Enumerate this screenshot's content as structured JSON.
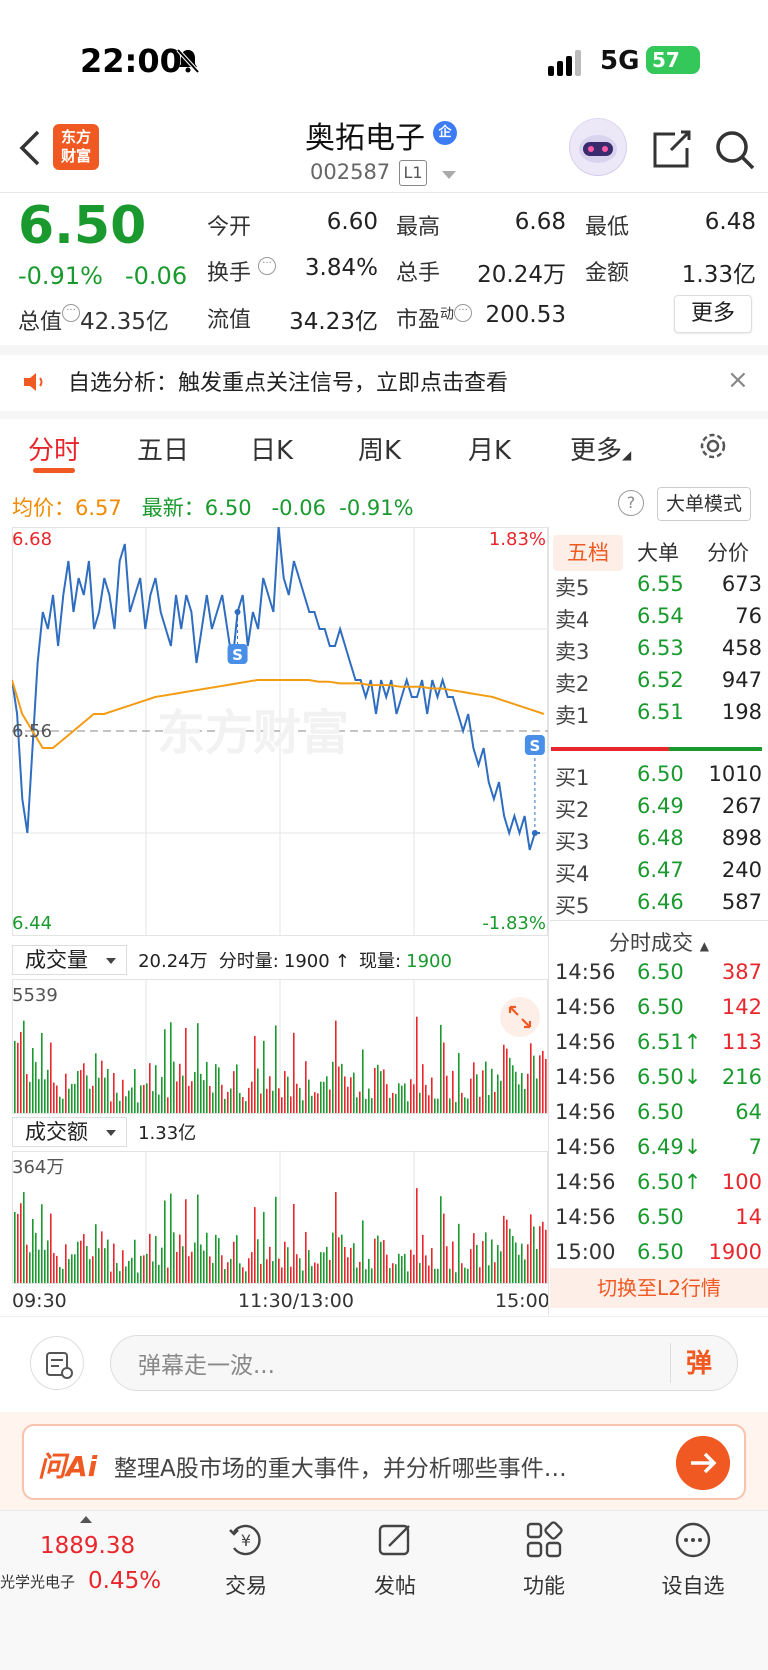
{
  "status_bar": {
    "time": "22:00",
    "network": "5G",
    "battery": "57"
  },
  "header": {
    "logo_text": "东方财富",
    "stock_name": "奥拓电子",
    "verify_badge": "企",
    "stock_code": "002587",
    "level": "L1"
  },
  "quote": {
    "price": "6.50",
    "change_pct": "-0.91%",
    "change_abs": "-0.06",
    "rows": [
      [
        {
          "label": "今开",
          "value": "6.60",
          "color": "red"
        },
        {
          "label": "最高",
          "value": "6.68",
          "color": "red"
        },
        {
          "label": "最低",
          "value": "6.48",
          "color": "green"
        }
      ],
      [
        {
          "label": "换手",
          "value": "3.84%",
          "color": "black"
        },
        {
          "label": "总手",
          "value": "20.24万",
          "color": "black"
        },
        {
          "label": "金额",
          "value": "1.33亿",
          "color": "black"
        }
      ]
    ],
    "total_mv_label": "总值",
    "total_mv": "42.35亿",
    "float_mv_label": "流值",
    "float_mv": "34.23亿",
    "pe_label": "市盈",
    "pe_sup": "动",
    "pe": "200.53",
    "more": "更多"
  },
  "banner": {
    "text": "自选分析：触发重点关注信号，立即点击查看",
    "close": "×"
  },
  "tabs": [
    "分时",
    "五日",
    "日K",
    "周K",
    "月K",
    "更多"
  ],
  "avg_row": {
    "avg_label": "均价：",
    "avg_value": "6.57",
    "latest_label": "最新：",
    "latest_value": "6.50",
    "change": "-0.06",
    "change_pct": "-0.91%",
    "help": "?",
    "mode": "大单模式"
  },
  "chart_data": {
    "type": "line",
    "title": "",
    "ylim": [
      6.44,
      6.68
    ],
    "y_top_label": "6.68",
    "y_bottom_label": "6.44",
    "y_mid_label": "6.56",
    "pct_top": "1.83%",
    "pct_bottom": "-1.83%",
    "x_labels": [
      "09:30",
      "11:30/13:00",
      "15:00"
    ],
    "series": [
      {
        "values": [
          6.59,
          6.57,
          6.52,
          6.5,
          6.55,
          6.6,
          6.63,
          6.62,
          6.64,
          6.61,
          6.64,
          6.66,
          6.63,
          6.65,
          6.64,
          6.66,
          6.62,
          6.63,
          6.65,
          6.64,
          6.62,
          6.66,
          6.67,
          6.63,
          6.64,
          6.65,
          6.62,
          6.64,
          6.65,
          6.63,
          6.62,
          6.61,
          6.64,
          6.62,
          6.64,
          6.63,
          6.6,
          6.62,
          6.64,
          6.62,
          6.63,
          6.64,
          6.62,
          6.6,
          6.63,
          6.64,
          6.61,
          6.63,
          6.62,
          6.65,
          6.64,
          6.63,
          6.68,
          6.65,
          6.64,
          6.66,
          6.65,
          6.64,
          6.63,
          6.63,
          6.62,
          6.62,
          6.61,
          6.61,
          6.62,
          6.61,
          6.6,
          6.59,
          6.59,
          6.58,
          6.59,
          6.57,
          6.59,
          6.58,
          6.59,
          6.57,
          6.58,
          6.59,
          6.58,
          6.58,
          6.59,
          6.57,
          6.59,
          6.58,
          6.59,
          6.58,
          6.58,
          6.57,
          6.56,
          6.57,
          6.55,
          6.54,
          6.55,
          6.53,
          6.52,
          6.53,
          6.51,
          6.5,
          6.51,
          6.5,
          6.51,
          6.49,
          6.5,
          6.5
        ]
      },
      {
        "values": [
          6.59,
          6.57,
          6.56,
          6.55,
          6.55,
          6.555,
          6.56,
          6.565,
          6.57,
          6.57,
          6.572,
          6.574,
          6.576,
          6.578,
          6.58,
          6.581,
          6.582,
          6.583,
          6.584,
          6.585,
          6.586,
          6.587,
          6.588,
          6.589,
          6.59,
          6.59,
          6.59,
          6.59,
          6.59,
          6.59,
          6.589,
          6.589,
          6.588,
          6.588,
          6.588,
          6.587,
          6.587,
          6.587,
          6.586,
          6.586,
          6.586,
          6.585,
          6.585,
          6.584,
          6.583,
          6.582,
          6.581,
          6.58,
          6.578,
          6.576,
          6.574,
          6.572,
          6.57
        ]
      }
    ],
    "events": [
      {
        "label": "S"
      },
      {
        "label": "S"
      }
    ]
  },
  "volume": {
    "label": "成交量",
    "total": "20.24万",
    "minute_label": "分时量:",
    "minute_value": "1900",
    "arrow": "↑",
    "now_label": "现量:",
    "now_value": "1900",
    "max_label": "5539"
  },
  "amount": {
    "label": "成交额",
    "total": "1.33亿",
    "max_label": "364万"
  },
  "order_book": {
    "tabs": [
      "五档",
      "大单",
      "分价"
    ],
    "asks": [
      {
        "label": "卖5",
        "price": "6.55",
        "vol": "673"
      },
      {
        "label": "卖4",
        "price": "6.54",
        "vol": "76"
      },
      {
        "label": "卖3",
        "price": "6.53",
        "vol": "458"
      },
      {
        "label": "卖2",
        "price": "6.52",
        "vol": "947"
      },
      {
        "label": "卖1",
        "price": "6.51",
        "vol": "198"
      }
    ],
    "bids": [
      {
        "label": "买1",
        "price": "6.50",
        "vol": "1010"
      },
      {
        "label": "买2",
        "price": "6.49",
        "vol": "267"
      },
      {
        "label": "买3",
        "price": "6.48",
        "vol": "898"
      },
      {
        "label": "买4",
        "price": "6.47",
        "vol": "240"
      },
      {
        "label": "买5",
        "price": "6.46",
        "vol": "587"
      }
    ]
  },
  "ticks": {
    "title": "分时成交",
    "rows": [
      {
        "time": "14:56",
        "price": "6.50",
        "vol": "387",
        "vcolor": "red"
      },
      {
        "time": "14:56",
        "price": "6.50",
        "vol": "142",
        "vcolor": "red"
      },
      {
        "time": "14:56",
        "price": "6.51↑",
        "vol": "113",
        "vcolor": "red"
      },
      {
        "time": "14:56",
        "price": "6.50↓",
        "vol": "216",
        "vcolor": "green"
      },
      {
        "time": "14:56",
        "price": "6.50",
        "vol": "64",
        "vcolor": "green"
      },
      {
        "time": "14:56",
        "price": "6.49↓",
        "vol": "7",
        "vcolor": "green"
      },
      {
        "time": "14:56",
        "price": "6.50↑",
        "vol": "100",
        "vcolor": "red"
      },
      {
        "time": "14:56",
        "price": "6.50",
        "vol": "14",
        "vcolor": "red"
      },
      {
        "time": "15:00",
        "price": "6.50",
        "vol": "1900",
        "vcolor": "red"
      }
    ],
    "switch_l2": "切换至L2行情"
  },
  "comment": {
    "placeholder": "弹幕走一波...",
    "danmu": "弹"
  },
  "ai": {
    "logo": "问Ai",
    "text": "整理A股市场的重大事件，并分析哪些事件…"
  },
  "bottom_nav": {
    "index_value": "1889.38",
    "index_name": "光学光电子",
    "index_pct": "0.45%",
    "items": [
      "交易",
      "发帖",
      "功能",
      "设自选"
    ]
  },
  "colors": {
    "up": "#e8262c",
    "down": "#1a9a2e",
    "accent": "#f05a22",
    "avg_line": "#f39c12",
    "price_line": "#2f6dbf"
  }
}
